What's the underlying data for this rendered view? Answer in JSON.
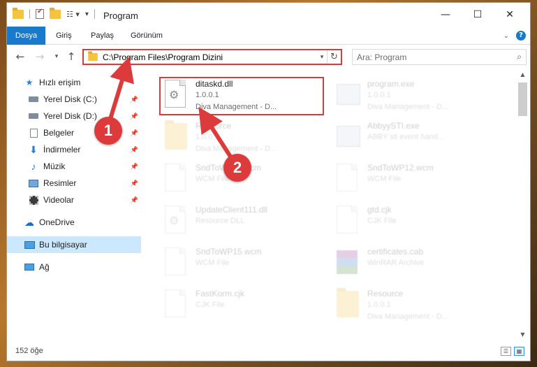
{
  "window": {
    "title": "Program",
    "controls": {
      "minimize": "—",
      "maximize": "☐",
      "close": "✕"
    }
  },
  "ribbon": {
    "tabs": [
      {
        "label": "Dosya",
        "active": true
      },
      {
        "label": "Giriş"
      },
      {
        "label": "Paylaş"
      },
      {
        "label": "Görünüm"
      }
    ],
    "help": "?"
  },
  "navbar": {
    "address": "C:\\Program Files\\Program Dizini",
    "search_placeholder": "Ara: Program"
  },
  "navpane": {
    "items": [
      {
        "label": "Hızlı erişim",
        "icon": "star-icon"
      },
      {
        "label": "Yerel Disk (C:)",
        "icon": "drive-icon",
        "pinned": true
      },
      {
        "label": "Yerel Disk (D:)",
        "icon": "drive-icon",
        "pinned": true
      },
      {
        "label": "Belgeler",
        "icon": "documents-icon",
        "pinned": true
      },
      {
        "label": "İndirmeler",
        "icon": "download-icon",
        "pinned": true
      },
      {
        "label": "Müzik",
        "icon": "music-icon",
        "pinned": true
      },
      {
        "label": "Resimler",
        "icon": "pictures-icon",
        "pinned": true
      },
      {
        "label": "Videolar",
        "icon": "videos-icon",
        "pinned": true
      },
      {
        "label": "OneDrive",
        "icon": "cloud-icon"
      },
      {
        "label": "Bu bilgisayar",
        "icon": "computer-icon",
        "selected": true
      },
      {
        "label": "Ağ",
        "icon": "network-icon"
      }
    ]
  },
  "files": [
    {
      "name": "ditaskd.dll",
      "line2": "1.0.0.1",
      "line3": "Diva Management - D...",
      "icon": "dll-gear-icon",
      "highlighted": true
    },
    {
      "name": "program.exe",
      "line2": "1.0.0.1",
      "line3": "Diva Management - D...",
      "icon": "exe-icon"
    },
    {
      "name": "Resource",
      "line2": "1.0.0.1",
      "line3": "Diva Management - D...",
      "icon": "folder-icon"
    },
    {
      "name": "AbbyySTI.exe",
      "line2": "ABBY sti event hand...",
      "line3": "",
      "icon": "exe-icon"
    },
    {
      "name": "SndToWP11.wcm",
      "line2": "WCM File",
      "line3": "",
      "icon": "document-icon"
    },
    {
      "name": "SndToWP12.wcm",
      "line2": "WCM File",
      "line3": "",
      "icon": "document-icon"
    },
    {
      "name": "UpdateClient111.dll",
      "line2": "Resource DLL",
      "line3": "",
      "icon": "dll-gear-icon"
    },
    {
      "name": "gtd.cjk",
      "line2": "CJK File",
      "line3": "",
      "icon": "document-icon"
    },
    {
      "name": "SndToWP15.wcm",
      "line2": "WCM File",
      "line3": "",
      "icon": "document-icon"
    },
    {
      "name": "certificates.cab",
      "line2": "WinRAR Archive",
      "line3": "",
      "icon": "archive-icon"
    },
    {
      "name": "FastKorm.cjk",
      "line2": "CJK File",
      "line3": "",
      "icon": "document-icon"
    },
    {
      "name": "Resource",
      "line2": "1.0.0.1",
      "line3": "Diva Management - D...",
      "icon": "folder-icon"
    }
  ],
  "status": {
    "count": "152 öğe"
  },
  "annotations": {
    "step1": "1",
    "step2": "2",
    "color": "#dd3b3b"
  }
}
